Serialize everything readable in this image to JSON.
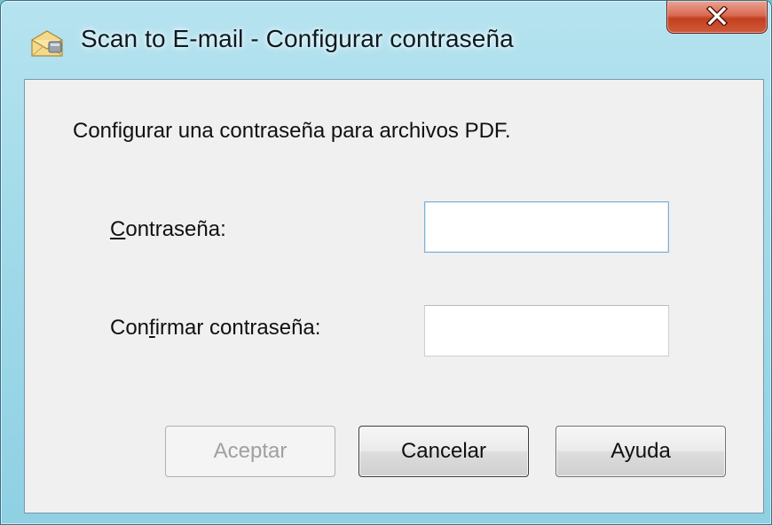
{
  "window": {
    "title": "Scan to E-mail - Configurar contraseña",
    "icon": "envelope-scan-icon",
    "close_glyph": "X"
  },
  "dialog": {
    "instruction": "Configurar una contraseña para archivos PDF.",
    "password_label": {
      "accel": "C",
      "rest": "ontraseña:"
    },
    "confirm_label": {
      "before": "Con",
      "accel": "f",
      "after": "irmar contraseña:"
    },
    "password_value": "",
    "confirm_value": ""
  },
  "buttons": {
    "accept": "Aceptar",
    "cancel": "Cancelar",
    "help": "Ayuda"
  },
  "states": {
    "accept_enabled": false
  }
}
